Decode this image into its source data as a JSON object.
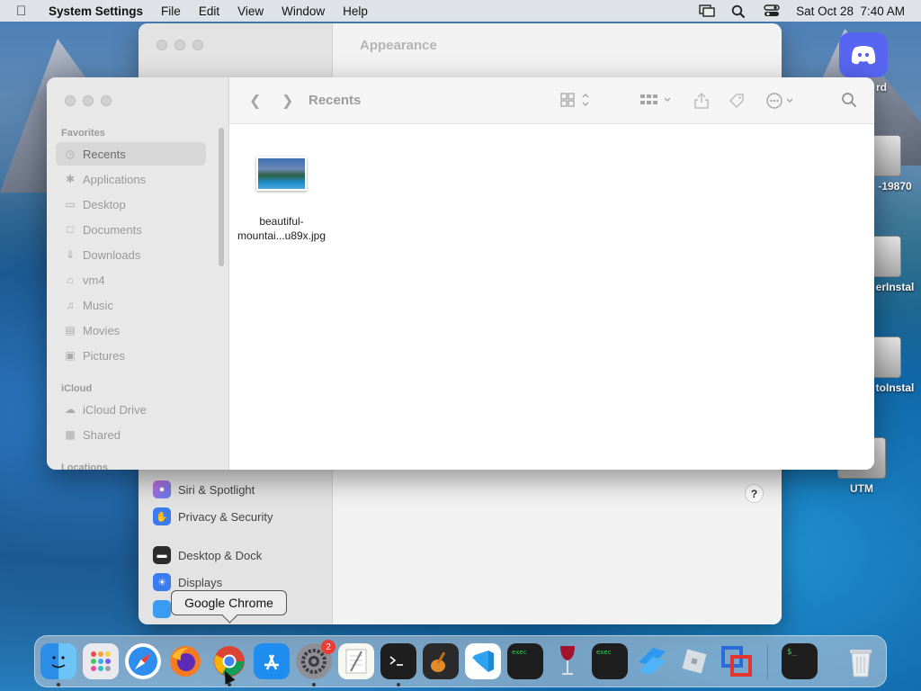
{
  "menubar": {
    "app_name": "System Settings",
    "menus": [
      "File",
      "Edit",
      "View",
      "Window",
      "Help"
    ],
    "datetime": "Sat Oct 28  7:40 AM"
  },
  "settings_window": {
    "title": "Appearance",
    "sidebar_items": [
      {
        "label": "Siri & Spotlight",
        "icon": "siri-icon",
        "color": "#8e5bd8"
      },
      {
        "label": "Privacy & Security",
        "icon": "hand-icon",
        "color": "#3a7cf0"
      },
      {
        "label": "Desktop & Dock",
        "icon": "dock-icon",
        "color": "#2c2c2c"
      },
      {
        "label": "Displays",
        "icon": "display-icon",
        "color": "#3a7cf0"
      }
    ],
    "help": "?"
  },
  "finder": {
    "title": "Recents",
    "sections": {
      "favorites": "Favorites",
      "icloud": "iCloud",
      "locations": "Locations"
    },
    "favorites": [
      {
        "label": "Recents",
        "icon": "clock-icon"
      },
      {
        "label": "Applications",
        "icon": "applications-icon"
      },
      {
        "label": "Desktop",
        "icon": "desktop-icon"
      },
      {
        "label": "Documents",
        "icon": "document-icon"
      },
      {
        "label": "Downloads",
        "icon": "download-icon"
      },
      {
        "label": "vm4",
        "icon": "home-icon"
      },
      {
        "label": "Music",
        "icon": "music-icon"
      },
      {
        "label": "Movies",
        "icon": "movie-icon"
      },
      {
        "label": "Pictures",
        "icon": "picture-icon"
      }
    ],
    "icloud": [
      {
        "label": "iCloud Drive",
        "icon": "cloud-icon"
      },
      {
        "label": "Shared",
        "icon": "shared-folder-icon"
      }
    ],
    "file": {
      "name_line1": "beautiful-",
      "name_line2": "mountai...u89x.jpg"
    }
  },
  "desktop": {
    "icons": [
      "rd",
      "-19870",
      "erInstal",
      "toInstal",
      "UTM"
    ]
  },
  "dock": {
    "tooltip": "Google Chrome",
    "settings_badge": "2",
    "apps": [
      "Finder",
      "Launchpad",
      "Safari",
      "Firefox",
      "Google Chrome",
      "App Store",
      "System Settings",
      "TextEdit",
      "Terminal",
      "GarageBand",
      "Visual Studio Code",
      "exec",
      "Wine",
      "exec",
      "Xcode",
      "Roblox",
      "VMware",
      "Terminal",
      "Trash"
    ]
  }
}
